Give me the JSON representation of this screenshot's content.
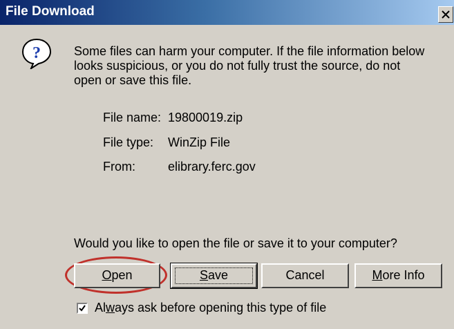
{
  "window": {
    "title": "File Download"
  },
  "message": {
    "warning": "Some files can harm your computer. If the file information below looks suspicious, or you do not fully trust the source, do not open or save this file."
  },
  "file_info": [
    {
      "label": "File name:",
      "value": "19800019.zip"
    },
    {
      "label": "File type:",
      "value": "WinZip File"
    },
    {
      "label": "From:",
      "value": "elibrary.ferc.gov"
    }
  ],
  "prompt": "Would you like to open the file or save it to your computer?",
  "buttons": {
    "open": {
      "mnemonic": "O",
      "rest": "pen"
    },
    "save": {
      "mnemonic": "S",
      "rest": "ave"
    },
    "cancel": "Cancel",
    "more_info": {
      "mnemonic": "M",
      "rest": "ore Info"
    }
  },
  "checkbox": {
    "checked": true,
    "label_before": "Al",
    "mnemonic": "w",
    "label_after": "ays ask before opening this type of file"
  },
  "icons": {
    "dialog_icon": "question-help-icon",
    "close": "close-icon"
  },
  "colors": {
    "title_bar_start": "#0a246a",
    "title_bar_end": "#a6caf0",
    "dialog_face": "#d4d0c8",
    "annotation_circle": "#c0312b"
  }
}
